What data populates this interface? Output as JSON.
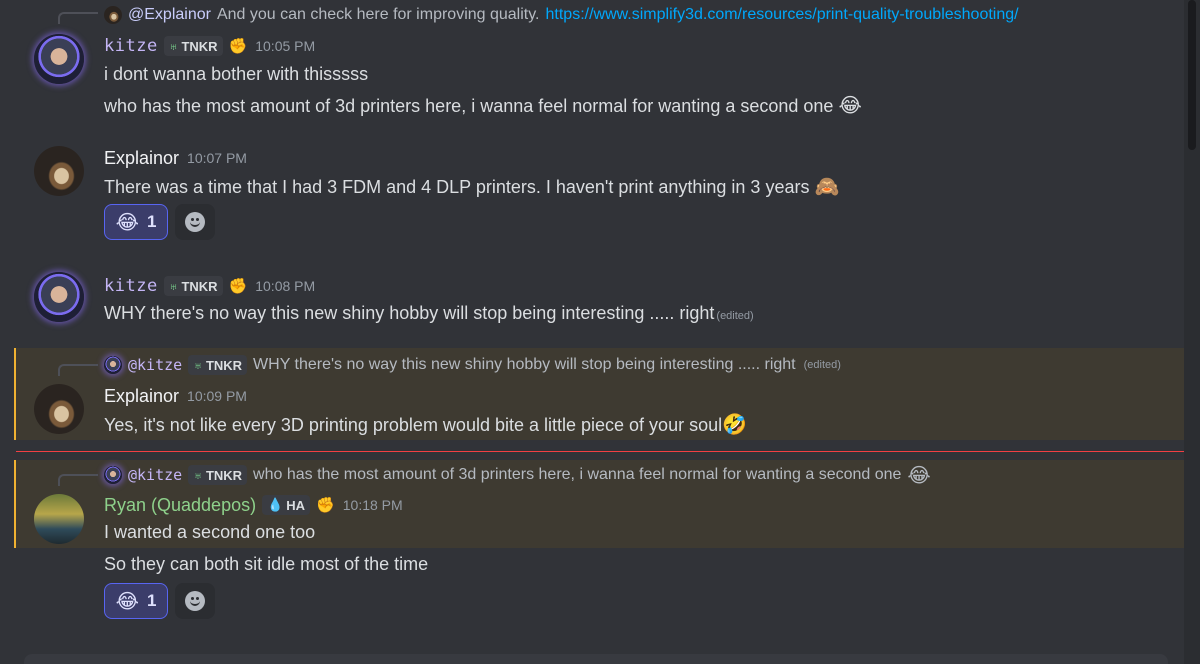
{
  "replies": [
    {
      "name": "@Explainor",
      "text": "And you can check here for improving quality.",
      "link": "https://www.simplify3d.com/resources/print-quality-troubleshooting/"
    },
    {
      "name": "@kitze",
      "tag": "TNKR",
      "text": "WHY there's no way this new shiny hobby will stop being interesting ..... right",
      "edited": "(edited)"
    },
    {
      "name": "@kitze",
      "tag": "TNKR",
      "text": "who has the most amount of 3d printers here, i wanna feel normal for wanting a second one",
      "emoji": "😂"
    }
  ],
  "messages": [
    {
      "author": "kitze",
      "tag": "TNKR",
      "time": "10:05 PM",
      "lines": [
        "i dont wanna bother with thisssss",
        "who has the most amount of 3d printers here, i wanna feel normal for wanting a second one"
      ],
      "emoji": "😂"
    },
    {
      "author": "Explainor",
      "time": "10:07 PM",
      "lines": [
        "There was a time that I had 3 FDM and 4 DLP printers. I haven't print anything in 3 years"
      ],
      "emoji": "🙈",
      "reaction": {
        "emoji": "😂",
        "count": "1"
      }
    },
    {
      "author": "kitze",
      "tag": "TNKR",
      "time": "10:08 PM",
      "lines": [
        "WHY there's no way this new shiny hobby will stop being interesting ..... right"
      ],
      "edited": "(edited)"
    },
    {
      "author": "Explainor",
      "time": "10:09 PM",
      "lines": [
        "Yes, it's not like every 3D printing problem would bite a little piece of your soul"
      ],
      "emoji": "🤣"
    },
    {
      "author": "Ryan (Quaddepos)",
      "tag": "HA",
      "time": "10:18 PM",
      "lines": [
        "I wanted a second one too",
        "So they can both sit idle most of the time"
      ],
      "reaction": {
        "emoji": "😂",
        "count": "1"
      }
    }
  ],
  "colors": {
    "highlight": "#3e3a31",
    "mention_bar": "#f0b232",
    "new_divider": "#f23f43",
    "link": "#00a8fc"
  }
}
